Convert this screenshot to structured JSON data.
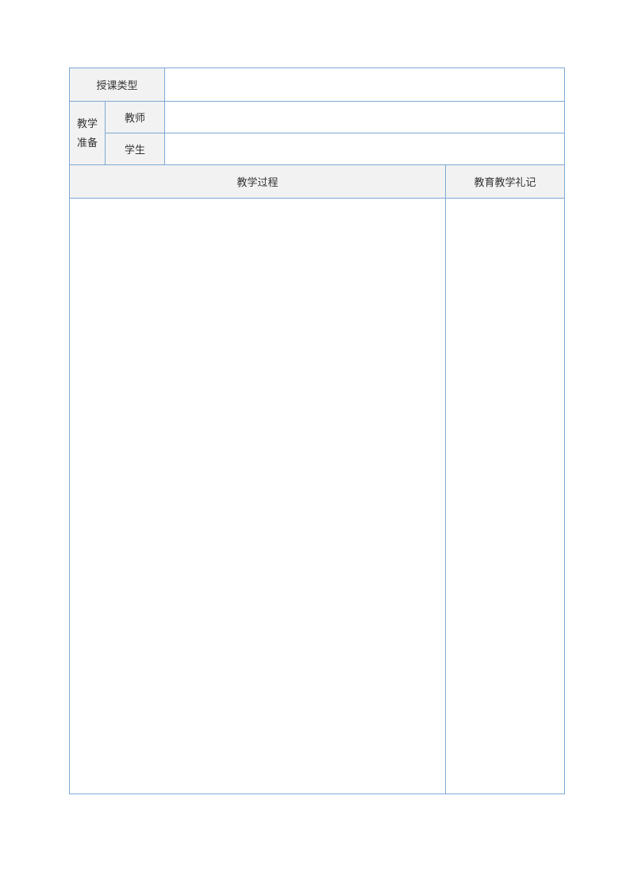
{
  "labels": {
    "lesson_type": "授课类型",
    "teaching_prep": "教学准备",
    "teacher": "教师",
    "student": "学生",
    "teaching_process": "教学过程",
    "teaching_notes": "教育教学礼记"
  },
  "values": {
    "lesson_type": "",
    "teacher_prep": "",
    "student_prep": "",
    "process_body": "",
    "notes_body": ""
  }
}
